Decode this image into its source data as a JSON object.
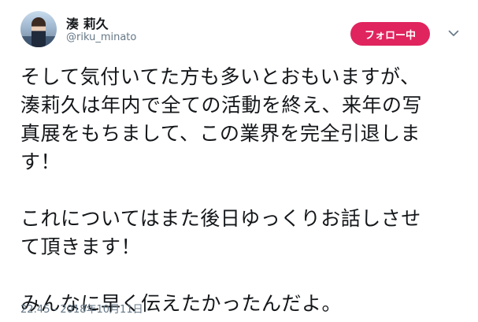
{
  "user": {
    "display_name": "湊 莉久",
    "handle": "@riku_minato"
  },
  "follow_button": {
    "label": "フォロー中",
    "color": "#e0245e"
  },
  "more_icon": "chevron-down-icon",
  "tweet": {
    "text": "そして気付いてた方も多いとおもいますが、\n湊莉久は年内で全ての活動を終え、来年の写\n真展をもちまして、この業界を完全引退しま\nす！\n\nこれについてはまた後日ゆっくりお話しさせ\nて頂きます！\n\nみんなに早く伝えたかったんだよ。",
    "timestamp": "22:45 - 2018年10月11日"
  }
}
